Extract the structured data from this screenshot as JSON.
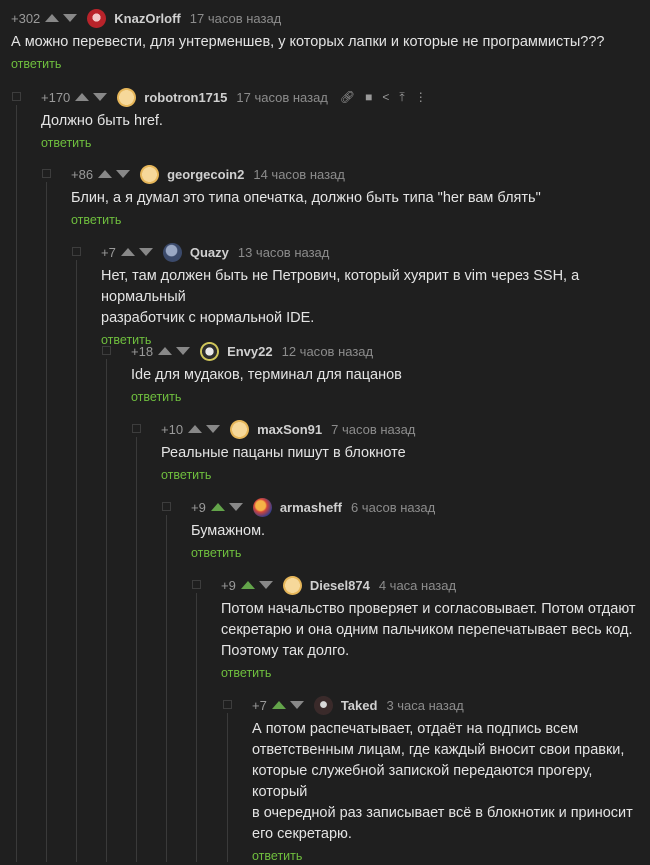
{
  "reply_label": "ответить",
  "colors": {
    "background": "#1f1f1f",
    "reply_green": "#6fbf3e",
    "rated_arrow": "#63a44a"
  },
  "comments": [
    {
      "rating": "+302",
      "author": "KnazOrloff",
      "time": "17 часов назад",
      "avatar_icon": "red-face-avatar",
      "lines": [
        "А можно перевести, для унтерменшев, у которых лапки и которые не программисты???"
      ]
    },
    {
      "rating": "+170",
      "author": "robotron1715",
      "time": "17 часов назад",
      "avatar_icon": "smiley-avatar",
      "tools": [
        "link-icon",
        "save-icon",
        "share-icon",
        "goto-parent-icon",
        "more-icon"
      ],
      "lines": [
        "Должно быть href."
      ]
    },
    {
      "rating": "+86",
      "author": "georgecoin2",
      "time": "14 часов назад",
      "avatar_icon": "smiley-avatar",
      "lines": [
        "Блин, а я думал это типа опечатка, должно быть типа \"her вам блять\""
      ]
    },
    {
      "rating": "+7",
      "author": "Quazy",
      "time": "13 часов назад",
      "avatar_icon": "photo-avatar",
      "lines": [
        "Нет, там должен быть не Петрович, который хуярит в vim через SSH, а нормальный",
        "разработчик с нормальной IDE."
      ]
    },
    {
      "rating": "+18",
      "author": "Envy22",
      "time": "12 часов назад",
      "avatar_icon": "gear-avatar",
      "lines": [
        "Ide для мудаков, терминал для пацанов"
      ]
    },
    {
      "rating": "+10",
      "author": "maxSon91",
      "time": "7 часов назад",
      "avatar_icon": "smiley-avatar",
      "lines": [
        "Реальные пацаны пишут в блокноте"
      ]
    },
    {
      "rating": "+9",
      "author": "armasheff",
      "time": "6 часов назад",
      "avatar_icon": "orb-avatar",
      "voted_up": true,
      "lines": [
        "Бумажном."
      ]
    },
    {
      "rating": "+9",
      "author": "Diesel874",
      "time": "4 часа назад",
      "avatar_icon": "smiley-avatar",
      "voted_up": true,
      "lines": [
        "Потом начальство проверяет и согласовывает. Потом отдают",
        "секретарю и она одним пальчиком перепечатывает весь код.",
        "Поэтому так долго."
      ]
    },
    {
      "rating": "+7",
      "author": "Taked",
      "time": "3 часа назад",
      "avatar_icon": "dark-avatar",
      "voted_up": true,
      "lines": [
        "А потом распечатывает, отдаёт на подпись всем",
        "ответственным лицам, где каждый вносит свои правки,",
        "которые служебной запиской передаются прогеру, который",
        "в очередной раз записывает всё в блокнотик и приносит",
        "его секретарю."
      ]
    }
  ]
}
